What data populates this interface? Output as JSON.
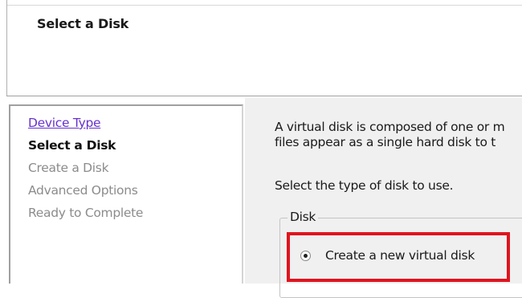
{
  "header": {
    "title": "Select a Disk"
  },
  "nav": {
    "items": [
      {
        "label": "Device Type",
        "state": "link"
      },
      {
        "label": "Select a Disk",
        "state": "current"
      },
      {
        "label": "Create a Disk",
        "state": "pending"
      },
      {
        "label": "Advanced Options",
        "state": "pending"
      },
      {
        "label": "Ready to Complete",
        "state": "pending"
      }
    ]
  },
  "content": {
    "description_line1": "A virtual disk is composed of one or m",
    "description_line2": "files appear as a single hard disk to t",
    "prompt": "Select the type of disk to use.",
    "group_label": "Disk",
    "options": [
      {
        "label": "Create a new virtual disk",
        "selected": true
      }
    ]
  },
  "colors": {
    "highlight": "#e0141e",
    "link": "#6633cc",
    "disabled": "#8c8c8c"
  }
}
